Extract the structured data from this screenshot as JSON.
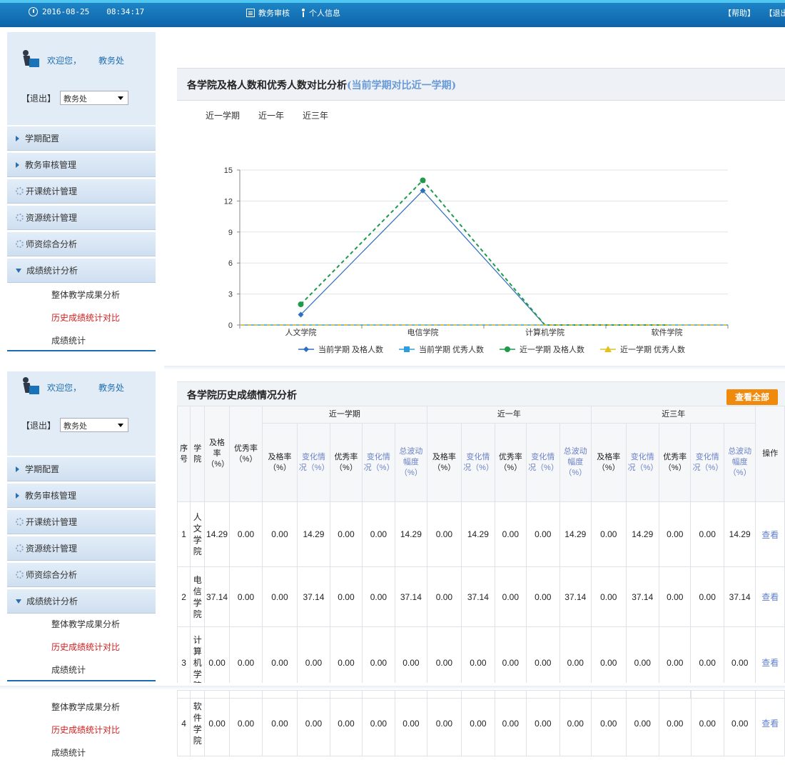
{
  "topbar": {
    "date": "2016-08-25",
    "time": "08:34:17",
    "nav": [
      "教务审核",
      "个人信息"
    ],
    "links": [
      "【帮助】",
      "【退出】"
    ]
  },
  "user": {
    "welcome": "欢迎您，",
    "name": "教务处",
    "logout": "【退出】",
    "role": "教务处"
  },
  "menu": {
    "items": [
      "学期配置",
      "教务审核管理",
      "开课统计管理",
      "资源统计管理",
      "师资综合分析",
      "成绩统计分析"
    ],
    "subitems": [
      "整体教学成果分析",
      "历史成绩统计对比",
      "成绩统计"
    ]
  },
  "chart_panel": {
    "title_main": "各学院及格人数和优秀人数对比分析",
    "title_sub": "(当前学期对比近一学期)",
    "periods": [
      "近一学期",
      "近一年",
      "近三年"
    ]
  },
  "chart_data": {
    "type": "line",
    "categories": [
      "人文学院",
      "电信学院",
      "计算机学院",
      "软件学院"
    ],
    "ylim": [
      0,
      15
    ],
    "yticks": [
      0,
      3,
      6,
      9,
      12,
      15
    ],
    "series": [
      {
        "name": "当前学期 及格人数",
        "values": [
          1,
          13,
          0,
          0
        ],
        "color": "#2f6fbf",
        "marker": "diamond",
        "dash": false
      },
      {
        "name": "当前学期 优秀人数",
        "values": [
          0,
          0,
          0,
          0
        ],
        "color": "#2c9ee0",
        "marker": "square",
        "dash": false
      },
      {
        "name": "近一学期 及格人数",
        "values": [
          2,
          14,
          0,
          0
        ],
        "color": "#1f9a4a",
        "marker": "circle",
        "dash": true
      },
      {
        "name": "近一学期 优秀人数",
        "values": [
          0,
          0,
          0,
          0
        ],
        "color": "#e5c21b",
        "marker": "triangle",
        "dash": true
      }
    ]
  },
  "table_panel": {
    "title": "各学院历史成绩情况分析",
    "view_all": "查看全部",
    "groups": [
      "近一学期",
      "近一年",
      "近三年"
    ],
    "head_seq": [
      "序",
      "号"
    ],
    "head_college": [
      "学",
      "院"
    ],
    "head_pass": "及格率（%）",
    "head_excellent": "优秀率（%）",
    "sub_headers": [
      {
        "label": "及格率（%）",
        "blue": false
      },
      {
        "label": "变化情况（%）",
        "blue": true
      },
      {
        "label": "优秀率（%）",
        "blue": false
      },
      {
        "label": "变化情况（%）",
        "blue": true
      },
      {
        "label": "总波动幅度（%）",
        "blue": true
      }
    ],
    "head_op": "操作",
    "view_label": "查看",
    "rows": [
      {
        "seq": "1",
        "college": "人文学院",
        "pass": "14.29",
        "excellent": "0.00",
        "groups": [
          [
            "0.00",
            "14.29",
            "0.00",
            "0.00",
            "14.29"
          ],
          [
            "0.00",
            "14.29",
            "0.00",
            "0.00",
            "14.29"
          ],
          [
            "0.00",
            "14.29",
            "0.00",
            "0.00",
            "14.29"
          ]
        ]
      },
      {
        "seq": "2",
        "college": "电信学院",
        "pass": "37.14",
        "excellent": "0.00",
        "groups": [
          [
            "0.00",
            "37.14",
            "0.00",
            "0.00",
            "37.14"
          ],
          [
            "0.00",
            "37.14",
            "0.00",
            "0.00",
            "37.14"
          ],
          [
            "0.00",
            "37.14",
            "0.00",
            "0.00",
            "37.14"
          ]
        ]
      },
      {
        "seq": "3",
        "college": "计算机学院",
        "pass": "0.00",
        "excellent": "0.00",
        "groups": [
          [
            "0.00",
            "0.00",
            "0.00",
            "0.00",
            "0.00"
          ],
          [
            "0.00",
            "0.00",
            "0.00",
            "0.00",
            "0.00"
          ],
          [
            "0.00",
            "0.00",
            "0.00",
            "0.00",
            "0.00"
          ]
        ]
      },
      {
        "seq": "4",
        "college": "软件学院",
        "pass": "0.00",
        "excellent": "0.00",
        "groups": [
          [
            "0.00",
            "0.00",
            "0.00",
            "0.00",
            "0.00"
          ],
          [
            "0.00",
            "0.00",
            "0.00",
            "0.00",
            "0.00"
          ],
          [
            "0.00",
            "0.00",
            "0.00",
            "0.00",
            "0.00"
          ]
        ]
      }
    ]
  }
}
